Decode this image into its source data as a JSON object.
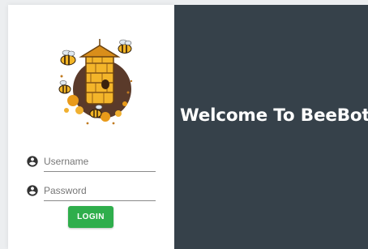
{
  "login": {
    "username_placeholder": "Username",
    "password_placeholder": "Password",
    "login_label": "LOGIN"
  },
  "welcome": {
    "title": "Welcome To BeeBot!"
  },
  "icons": {
    "logo": "beehive-logo",
    "username": "account-circle-icon",
    "password": "account-circle-icon"
  },
  "colors": {
    "panel": "#36414a",
    "button": "#2fae4c",
    "card": "#ffffff",
    "background": "#eceef0"
  }
}
